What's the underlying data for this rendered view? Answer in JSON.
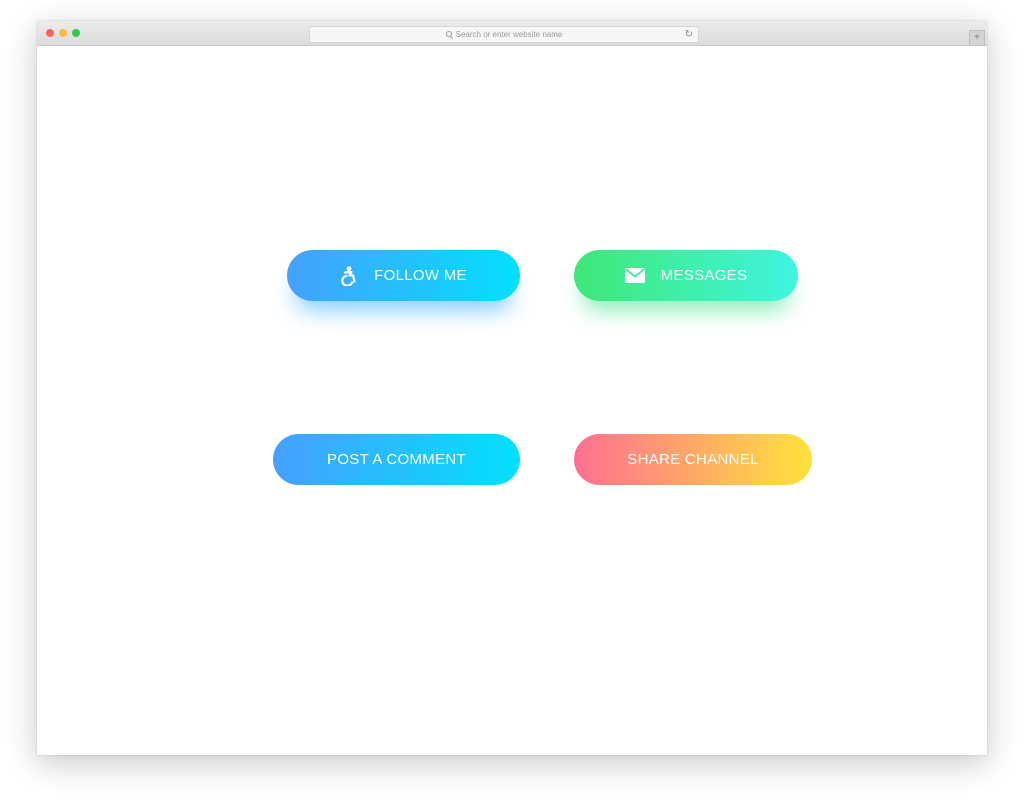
{
  "browser": {
    "url_placeholder": "Search or enter website name",
    "reload_glyph": "↻",
    "newtab_glyph": "+",
    "icons": [
      "search-icon",
      "reload-icon",
      "plus-icon"
    ]
  },
  "buttons": {
    "follow": {
      "label": "FOLLOW ME",
      "icon": "accessibility-icon",
      "gradient": [
        "#45a0fd",
        "#03e0fd"
      ]
    },
    "messages": {
      "label": "MESSAGES",
      "icon": "envelope-icon",
      "gradient": [
        "#3fe876",
        "#3ff5e0"
      ]
    },
    "comment": {
      "label": "POST A COMMENT",
      "gradient": [
        "#45a0fd",
        "#03e0fd"
      ]
    },
    "share": {
      "label": "SHARE CHANNEL",
      "gradient": [
        "#ff6f91",
        "#ffe23b"
      ]
    }
  }
}
